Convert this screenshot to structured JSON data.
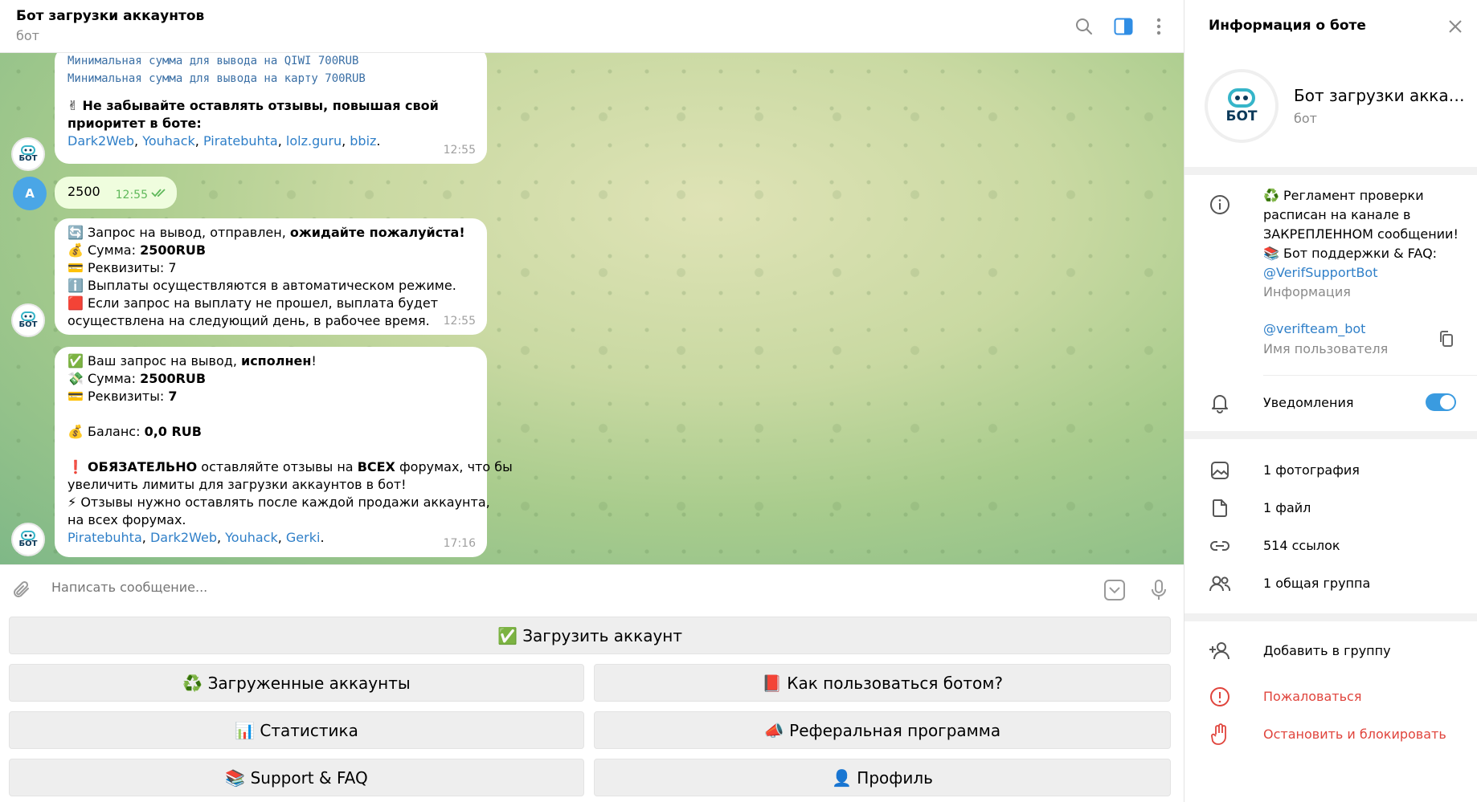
{
  "header": {
    "title": "Бот загрузки аккаунтов",
    "subtitle": "бот"
  },
  "messages": {
    "m1": {
      "mono1": "Минимальная сумма для вывода на QIWI 700RUB",
      "mono2": "Минимальная сумма для вывода на карту 700RUB",
      "reminder_emoji": "✌",
      "reminder": "Не забывайте оставлять отзывы, повышая свой",
      "reminder2": "приоритет в боте:",
      "links": [
        "Dark2Web",
        "Youhack",
        "Piratebuhta",
        "lolz.guru",
        "bbiz"
      ],
      "time": "12:55"
    },
    "m2": {
      "text": "2500",
      "time": "12:55",
      "avatar": "A"
    },
    "m3": {
      "l1_pre": "🔄 Запрос на вывод,  отправлен, ",
      "l1_bold": "ожидайте пожалуйста!",
      "l2_pre": "💰 Сумма: ",
      "l2_bold": "2500RUB",
      "l3": "💳 Реквизиты: 7",
      "l4": "ℹ️ Выплаты осуществляются в автоматическом режиме.",
      "l5": "🟥 Если запрос на выплату не прошел, выплата будет",
      "l6": "осуществлена на следующий день, в рабочее время.",
      "time": "12:55"
    },
    "m4": {
      "l1_pre": "✅ Ваш запрос на вывод, ",
      "l1_bold": "исполнен",
      "l1_post": "!",
      "l2_pre": "💸 Сумма: ",
      "l2_bold": "2500RUB",
      "l3_pre": "💳 Реквизиты: ",
      "l3_bold": "7",
      "l4_pre": "💰 Баланс: ",
      "l4_bold": "0,0 RUB",
      "l5_emoji": "❗",
      "l5_bold1": "ОБЯЗАТЕЛЬНО",
      "l5_mid": " оставляйте отзывы на ",
      "l5_bold2": "ВСЕХ",
      "l5_post": " форумах, что бы",
      "l6": "увеличить лимиты для загрузки аккаунтов в бот!",
      "l7": "⚡ Отзывы нужно оставлять после каждой продажи аккаунта,",
      "l8": "на всех форумах.",
      "links": [
        "Piratebuhta",
        "Dark2Web",
        "Youhack",
        "Gerki"
      ],
      "time": "17:16"
    }
  },
  "composer": {
    "placeholder": "Написать сообщение..."
  },
  "keyboard": {
    "upload": "✅ Загрузить аккаунт",
    "uploaded": "♻️ Загруженные аккаунты",
    "howto": "📕 Как пользоваться ботом?",
    "stats": "📊 Статистика",
    "referral": "📣 Реферальная программа",
    "support": "📚 Support & FAQ",
    "profile": "👤 Профиль"
  },
  "panel": {
    "title": "Информация о боте",
    "name": "Бот загрузки аккаунтов",
    "subtitle": "бот",
    "avatar_text": "БОТ",
    "info_l1": "♻️ Регламент проверки",
    "info_l2": "расписан на канале в",
    "info_l3": "ЗАКРЕПЛЕННОМ сообщении!",
    "info_l4": "📚 Бот поддержки & FAQ:",
    "info_link": "@VerifSupportBot",
    "info_label": "Информация",
    "username": "@verifteam_bot",
    "username_label": "Имя пользователя",
    "notifications": "Уведомления",
    "photos": "1 фотография",
    "files": "1 файл",
    "links": "514 ссылок",
    "groups": "1 общая группа",
    "add_to_group": "Добавить в группу",
    "report": "Пожаловаться",
    "block": "Остановить и блокировать"
  },
  "colors": {
    "accent": "#3a9be0",
    "link": "#2f7fc8",
    "danger": "#e0443c",
    "outgoing_bubble": "#effdde"
  }
}
